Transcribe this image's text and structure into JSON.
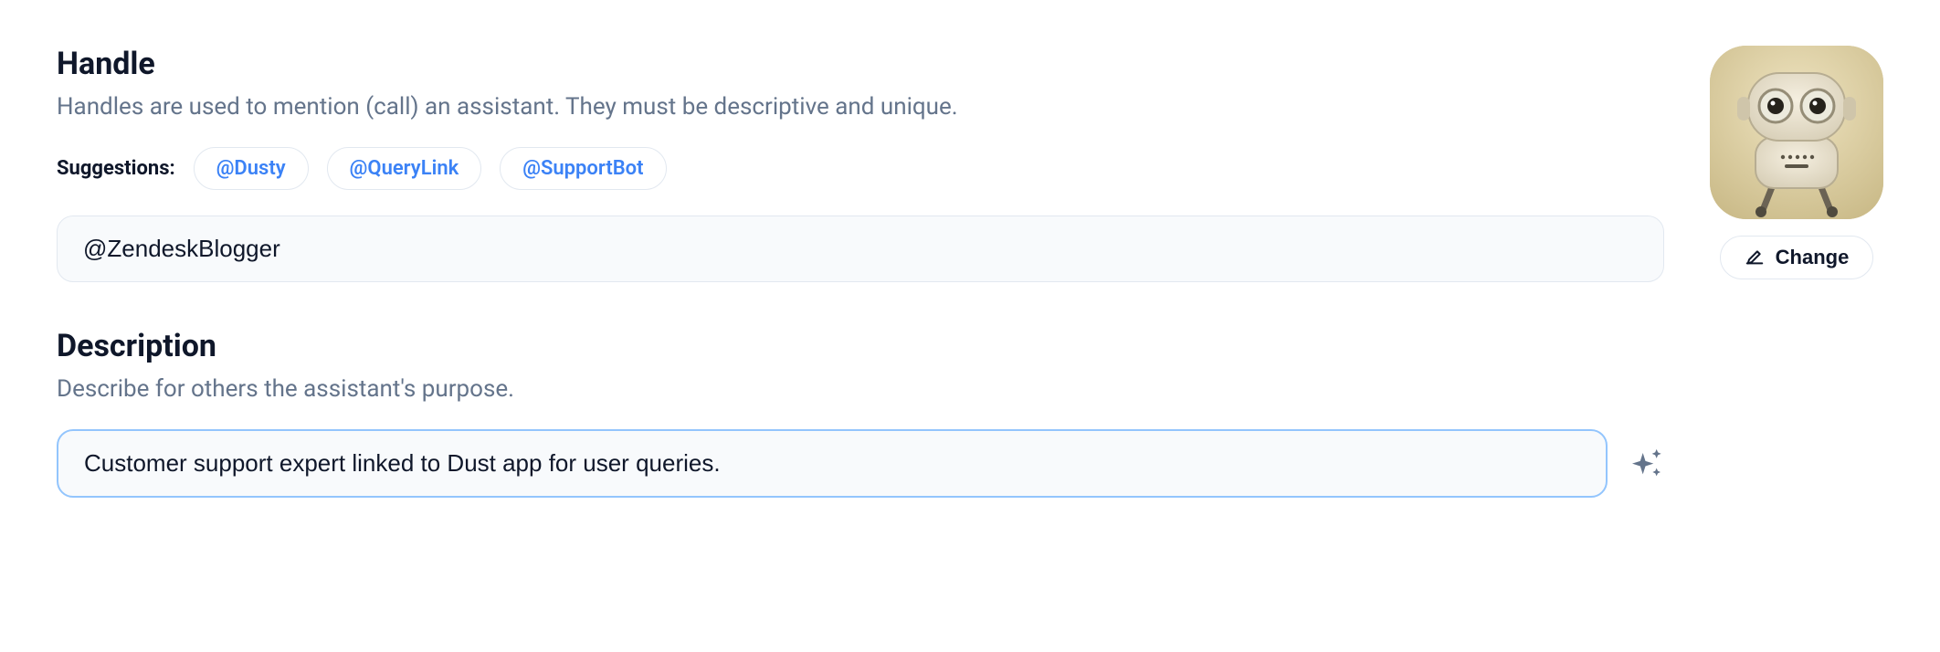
{
  "handle": {
    "title": "Handle",
    "subtitle": "Handles are used to mention (call) an assistant. They must be descriptive and unique.",
    "suggestions_label": "Suggestions:",
    "suggestions": [
      "@Dusty",
      "@QueryLink",
      "@SupportBot"
    ],
    "value": "@ZendeskBlogger"
  },
  "description": {
    "title": "Description",
    "subtitle": "Describe for others the assistant's purpose.",
    "value": "Customer support expert linked to Dust app for user queries."
  },
  "avatar": {
    "change_label": "Change"
  }
}
